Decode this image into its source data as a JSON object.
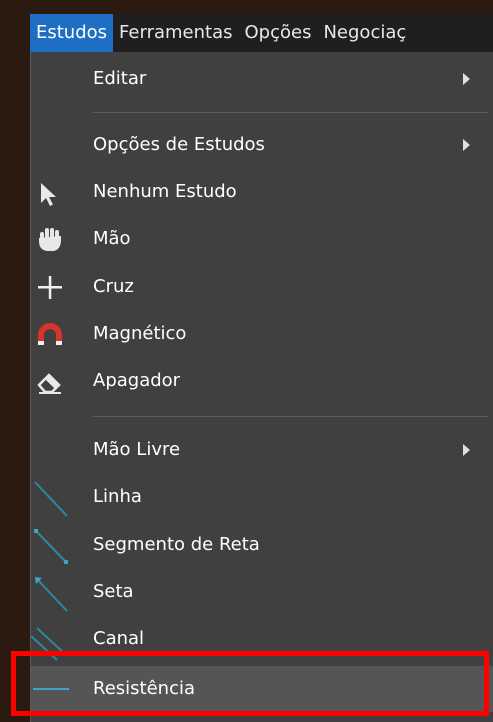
{
  "menubar": {
    "items": [
      {
        "label": "Estudos",
        "active": true
      },
      {
        "label": "Ferramentas"
      },
      {
        "label": "Opções"
      },
      {
        "label": "Negociaç"
      }
    ]
  },
  "menu": {
    "items": [
      {
        "label": "Editar",
        "submenu": true
      },
      {
        "label": "Opções de Estudos",
        "submenu": true
      },
      {
        "label": "Nenhum Estudo",
        "icon": "cursor-arrow-icon"
      },
      {
        "label": "Mão",
        "icon": "hand-icon"
      },
      {
        "label": "Cruz",
        "icon": "crosshair-plus-icon"
      },
      {
        "label": "Magnético",
        "icon": "magnet-icon"
      },
      {
        "label": "Apagador",
        "icon": "eraser-icon"
      },
      {
        "label": "Mão Livre",
        "submenu": true
      },
      {
        "label": "Linha",
        "icon": "line-icon"
      },
      {
        "label": "Segmento de Reta",
        "icon": "line-segment-icon"
      },
      {
        "label": "Seta",
        "icon": "arrow-line-icon"
      },
      {
        "label": "Canal",
        "icon": "channel-icon"
      },
      {
        "label": "Resistência",
        "icon": "horizontal-line-icon",
        "highlighted": true
      }
    ]
  },
  "colors": {
    "accent": "#1e6fc4",
    "menu_bg": "#404040",
    "icon_line": "#2a8aa0",
    "highlight_box": "#ff0000"
  }
}
